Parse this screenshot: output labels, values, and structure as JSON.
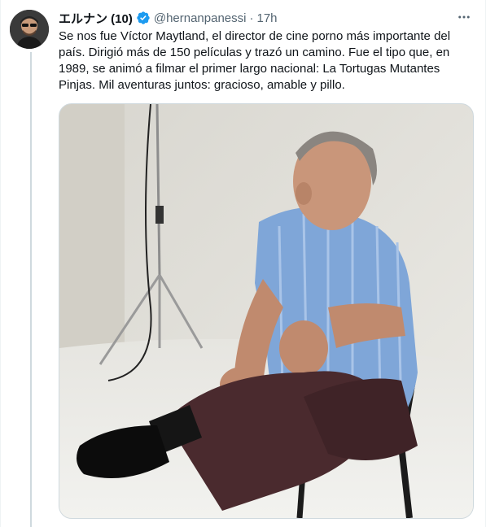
{
  "tweet": {
    "display_name": "エルナン (10)",
    "handle": "@hernanpanessi",
    "separator": "·",
    "time": "17h",
    "text": "Se nos fue Víctor Maytland, el director de cine porno más importante del país. Dirigió más de 150 películas y trazó un camino. Fue el tipo que, en 1989, se animó a filmar el primer largo nacional: La Tortugas Mutantes Pinjas. Mil aventuras juntos: gracioso, amable y pillo."
  },
  "icons": {
    "verified": "verified-badge-icon",
    "more": "more-options-icon"
  },
  "colors": {
    "accent": "#1d9bf0",
    "secondary_text": "#536471",
    "border": "#cfd9de"
  }
}
